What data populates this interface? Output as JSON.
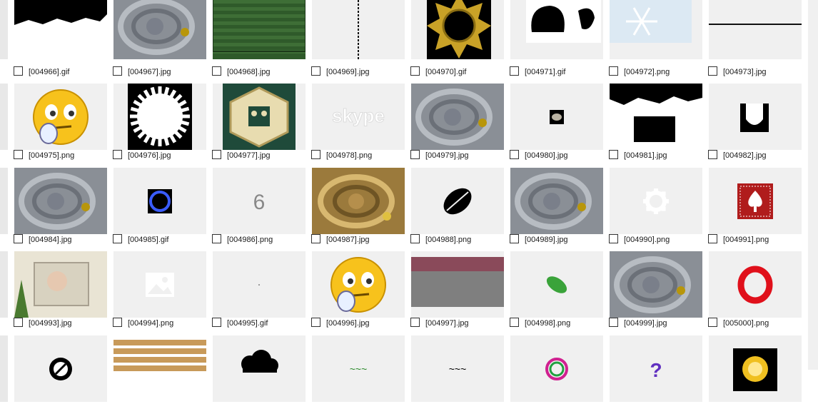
{
  "rows": [
    {
      "items": [
        {
          "label": "[004966].gif",
          "icon": "black-white-silhouette-image"
        },
        {
          "label": "[004967].jpg",
          "icon": "stone-maze-image"
        },
        {
          "label": "[004968].jpg",
          "icon": "green-stripes-image"
        },
        {
          "label": "[004969].jpg",
          "icon": "vertical-line-image"
        },
        {
          "label": "[004970].gif",
          "icon": "gold-star-ring-image"
        },
        {
          "label": "[004971].gif",
          "icon": "black-blobs-image"
        },
        {
          "label": "[004972].png",
          "icon": "snowflake-image"
        },
        {
          "label": "[004973].jpg",
          "icon": "horizontal-line-image"
        }
      ]
    },
    {
      "items": [
        {
          "label": "[004975].png",
          "icon": "thinking-emoji-image"
        },
        {
          "label": "[004976].jpg",
          "icon": "white-gear-circle-image"
        },
        {
          "label": "[004977].jpg",
          "icon": "ornate-hexagon-image"
        },
        {
          "label": "[004978].png",
          "icon": "skype-logo-image",
          "text": "skype"
        },
        {
          "label": "[004979].jpg",
          "icon": "stone-maze-image"
        },
        {
          "label": "[004980].jpg",
          "icon": "small-stone-image"
        },
        {
          "label": "[004981].jpg",
          "icon": "black-frame-image"
        },
        {
          "label": "[004982].jpg",
          "icon": "shield-shape-image"
        }
      ]
    },
    {
      "items": [
        {
          "label": "[004984].jpg",
          "icon": "stone-maze-image"
        },
        {
          "label": "[004985].gif",
          "icon": "blue-ring-image"
        },
        {
          "label": "[004986].png",
          "icon": "number-six-image",
          "text": "6"
        },
        {
          "label": "[004987].jpg",
          "icon": "golden-maze-image"
        },
        {
          "label": "[004988].png",
          "icon": "black-leaf-image"
        },
        {
          "label": "[004989].jpg",
          "icon": "stone-maze-image"
        },
        {
          "label": "[004990].png",
          "icon": "white-gear-image"
        },
        {
          "label": "[004991].png",
          "icon": "spade-card-image"
        }
      ]
    },
    {
      "items": [
        {
          "label": "[004993].jpg",
          "icon": "winter-photo-image"
        },
        {
          "label": "[004994].png",
          "icon": "image-placeholder-icon"
        },
        {
          "label": "[004995].gif",
          "icon": "tiny-dot-image"
        },
        {
          "label": "[004996].jpg",
          "icon": "thinking-emoji-image"
        },
        {
          "label": "[004997].jpg",
          "icon": "gray-block-image"
        },
        {
          "label": "[004998].png",
          "icon": "green-leaf-image"
        },
        {
          "label": "[004999].jpg",
          "icon": "stone-maze-image"
        },
        {
          "label": "[005000].png",
          "icon": "opera-logo-image"
        }
      ]
    },
    {
      "items": [
        {
          "label": "",
          "icon": "crossed-circle-image"
        },
        {
          "label": "",
          "icon": "wood-planks-image"
        },
        {
          "label": "",
          "icon": "black-cloud-image"
        },
        {
          "label": "",
          "icon": "colored-text-image"
        },
        {
          "label": "",
          "icon": "black-text-image"
        },
        {
          "label": "",
          "icon": "rainbow-ring-image"
        },
        {
          "label": "",
          "icon": "purple-question-image"
        },
        {
          "label": "",
          "icon": "gold-glow-image"
        }
      ]
    }
  ],
  "colors": {
    "tile_bg": "#f0f0f0",
    "label": "#1a1a1a",
    "stone": "#8a8f96",
    "gold": "#b8960a",
    "green_dark": "#2f5a2a",
    "spade_red": "#b01c1c",
    "opera_red": "#e0101b"
  }
}
